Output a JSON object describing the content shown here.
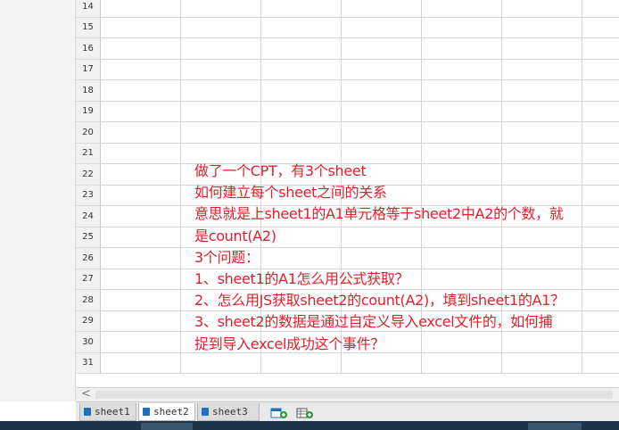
{
  "rows": [
    "14",
    "15",
    "16",
    "17",
    "18",
    "19",
    "20",
    "21",
    "22",
    "23",
    "24",
    "25",
    "26",
    "27",
    "28",
    "29",
    "30",
    "31"
  ],
  "note_lines": [
    "做了一个CPT，有3个sheet",
    "如何建立每个sheet之间的关系",
    "意思就是上sheet1的A1单元格等于sheet2中A2的个数，就",
    "是count(A2)",
    "3个问题：",
    "1、sheet1的A1怎么用公式获取？",
    "2、怎么用JS获取sheet2的count(A2)，填到sheet1的A1？",
    "3、sheet2的数据是通过自定义导入excel文件的，如何捕",
    "捉到导入excel成功这个事件？"
  ],
  "tabs": [
    "sheet1",
    "sheet2",
    "sheet3"
  ],
  "active_tab": "sheet2",
  "scroll_left_arrow": "<",
  "colors": {
    "note": "#e0202a",
    "tab_icon": "#1f6fbf",
    "taskbar": "#1e3347"
  }
}
